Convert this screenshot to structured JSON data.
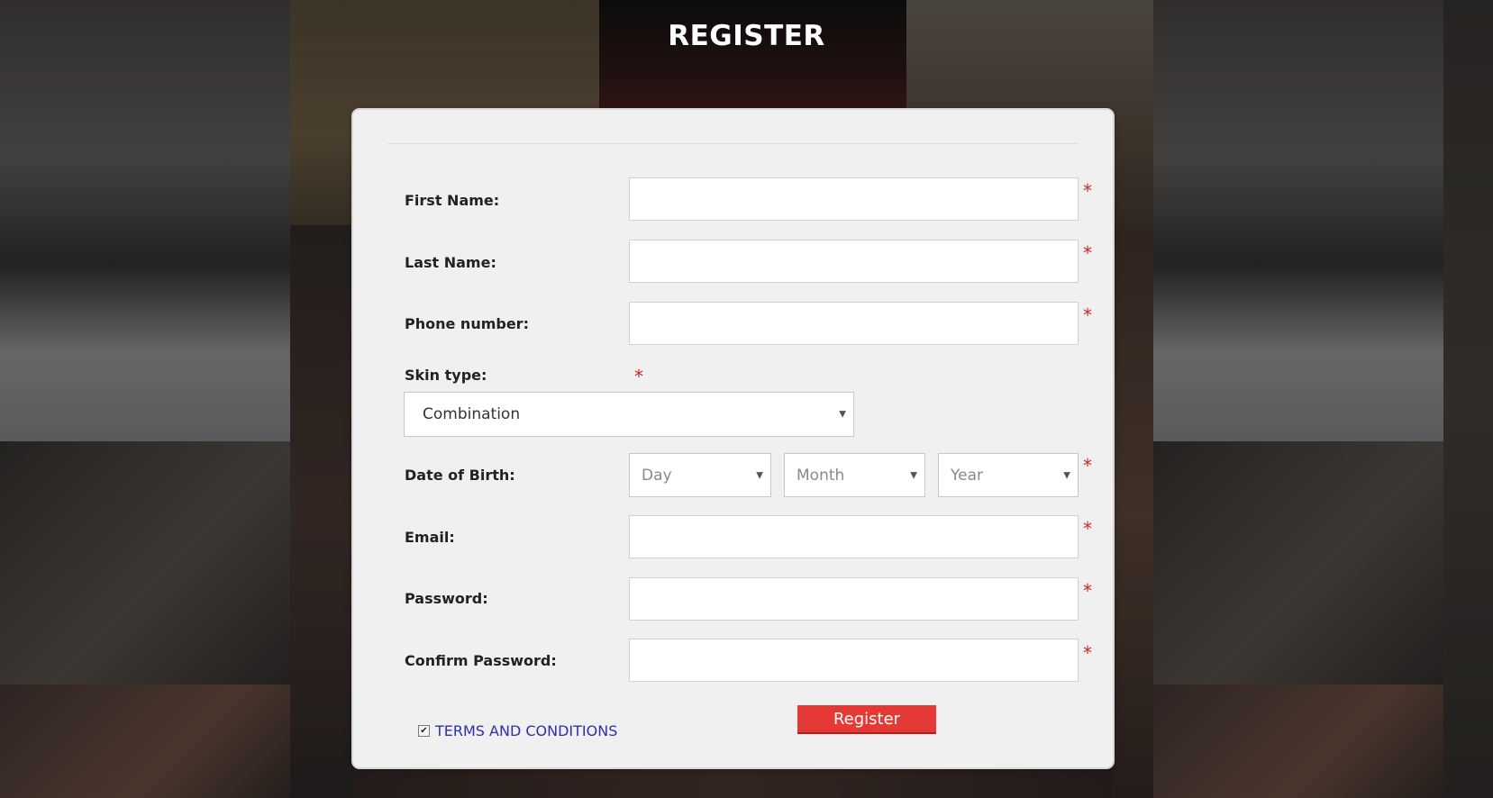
{
  "page": {
    "title": "REGISTER"
  },
  "form": {
    "first_name_label": "First Name:",
    "last_name_label": "Last Name:",
    "phone_label": "Phone number:",
    "skin_type_label": "Skin type:",
    "skin_type_value": "Combination",
    "dob_label": "Date of Birth:",
    "dob_day": "Day",
    "dob_month": "Month",
    "dob_year": "Year",
    "email_label": "Email:",
    "password_label": "Password:",
    "confirm_password_label": "Confirm Password:",
    "required_mark": "*",
    "terms_checked_mark": "✔",
    "terms_label": "TERMS AND CONDITIONS",
    "register_button": "Register"
  },
  "colors": {
    "card_bg": "#f1f0f0",
    "required": "#c82828",
    "register_button": "#e53935",
    "terms_link": "#2f2fa8"
  }
}
